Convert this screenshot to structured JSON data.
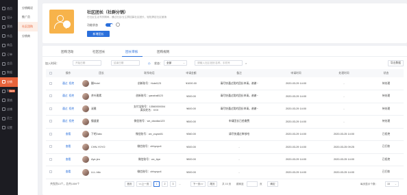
{
  "sidebar_dark": {
    "items": [
      {
        "label": "首页"
      },
      {
        "label": "设计"
      },
      {
        "label": "营销"
      },
      {
        "label": "作品"
      },
      {
        "label": "商品"
      },
      {
        "label": "订单"
      },
      {
        "label": "会员"
      },
      {
        "label": "数据"
      },
      {
        "label": "分销"
      },
      {
        "label": "财务"
      },
      {
        "label": "营销"
      },
      {
        "label": "店铺"
      },
      {
        "label": "员工"
      },
      {
        "label": "设置"
      }
    ],
    "active_index": 8,
    "new_badge": "NEW"
  },
  "sidebar_light": {
    "items": [
      {
        "label": "分销概况"
      },
      {
        "label": "推广员"
      },
      {
        "label": "社区团购"
      },
      {
        "label": "分销商"
      }
    ],
    "active_index": 2
  },
  "plugin": {
    "title": "社区团长（社群分销）",
    "desc": "在社区生活节庆期间，通过社区/业主群招募社区团长，轻松搞定社区营销",
    "toggle_label": "功能状态",
    "toggle_on": true,
    "button_label": "新增团长",
    "thumb_color": "#f7b34b"
  },
  "tabs": {
    "items": [
      {
        "label": "团购活动"
      },
      {
        "label": "社区团长"
      },
      {
        "label": "团长审核"
      },
      {
        "label": "团购规则"
      }
    ],
    "active_index": 2
  },
  "filters": {
    "time_label": "加入时间：",
    "start_placeholder": "开始日期",
    "end_placeholder": "结束日期",
    "status_label": "状态：",
    "status_value": "全部",
    "search_placeholder": "请输入社区/团长名称、手机号",
    "export_label": "导出数据"
  },
  "table": {
    "headers": [
      "",
      "操作",
      "团长",
      "联系电话",
      "申请金额",
      "备注",
      "申请时间",
      "处理时间",
      "状态"
    ],
    "rows": [
      {
        "ops": [
          "通过",
          "拒绝"
        ],
        "name": "翻Hotel",
        "contact": [
          "创新账号：Hotel123"
        ],
        "amount": "¥1000.00",
        "remark": "请尽快通过我的团长申请，谢谢~",
        "applied": "2020-03-29 14:00",
        "processed": "-",
        "status": "待处理"
      },
      {
        "ops": [
          "通过",
          "拒绝"
        ],
        "name": "茶叶雅素",
        "contact": [
          "创新账号：yanahall123"
        ],
        "amount": "¥300.00",
        "remark": "请尽快通过我的团长申请，谢谢~",
        "applied": "2020-03-29 14:00",
        "processed": "-",
        "status": "待处理"
      },
      {
        "ops": [
          "通过",
          "拒绝"
        ],
        "name": "淑雅",
        "contact": [
          "支付宝账号：13560000004",
          "真实姓名：XXX"
        ],
        "amount": "¥600.00",
        "remark": "请尽快通过我的团长申请，谢谢~",
        "applied": "2020-03-29 14:00",
        "processed": "-",
        "status": "待处理"
      },
      {
        "ops": [
          "通过",
          "拒绝"
        ],
        "name": "撞道屋",
        "contact": [
          "微信账号：wx_daodao123"
        ],
        "amount": "¥500.00",
        "remark": "申请团长已经缴费",
        "applied": "2020-03-29 14:00",
        "processed": "-",
        "status": "待处理"
      },
      {
        "ops": [
          "查看"
        ],
        "name": "下吧2abc",
        "contact": [
          "微信账号：wx_zuyan01"
        ],
        "amount": "¥360.00",
        "remark": "请尽快通过审核哈",
        "applied": "2020-03-29 14:00",
        "processed": "2020-03-25 14:00",
        "status": "已拒绝"
      },
      {
        "ops": [
          "查看"
        ],
        "name": "CHN-YOYO",
        "contact": [
          "微信账号：chhyoyo4"
        ],
        "amount": "¥300.00",
        "remark": "-",
        "applied": "2020-03-29 14:00",
        "processed": "2020-03-25 09:25",
        "status": "已打款"
      },
      {
        "ops": [
          "查看"
        ],
        "name": "Aye-jeu",
        "contact": [
          "微信账号：wx_Aye"
        ],
        "amount": "¥500.00",
        "remark": "-",
        "applied": "2020-03-29 14:00",
        "processed": "2020-03-25 14:00",
        "status": "已拒绝"
      },
      {
        "ops": [
          "查看"
        ],
        "name": "LLL-htlo",
        "contact": [
          "微信账号：chhyoyo4"
        ],
        "amount": "¥300.00",
        "remark": "-",
        "applied": "2020-03-29 14:00",
        "processed": "2020-03-25 14:00",
        "status": "已打款"
      }
    ]
  },
  "pagination": {
    "total": "共找到13个，总共1059个",
    "first": "首页",
    "prev": "<<上一页",
    "pages": [
      "1",
      "2",
      "3"
    ],
    "ellipsis": "...",
    "next": "下一页>>",
    "last": "尾页",
    "total_pages": "共 15 页",
    "goto_label": "跳转至",
    "goto_page": "页",
    "go": "确定",
    "per_page_label": "每页显示个数：",
    "per_page_value": "15"
  },
  "colors": {
    "accent": "#2a6fdb",
    "brand_orange": "#e8643c"
  }
}
